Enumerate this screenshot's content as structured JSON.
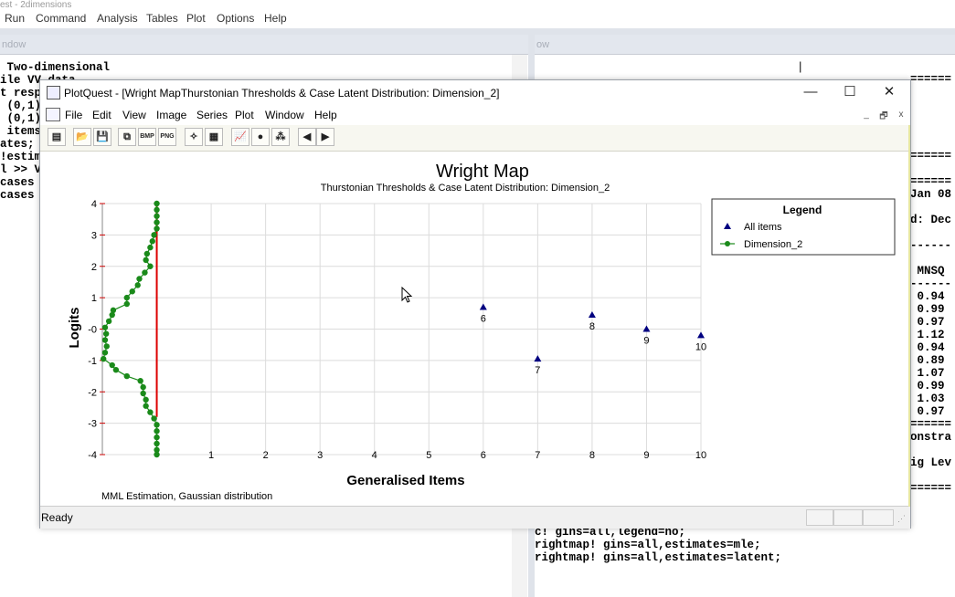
{
  "background_app": {
    "title_fragment": "est - 2dimensions",
    "menu": [
      "Run",
      "Command",
      "Analysis",
      "Tables",
      "Plot",
      "Options",
      "Help"
    ],
    "left_pane_title": "ndow",
    "right_pane_title": "ow",
    "left_text": [
      " Two-dimensional",
      "ile VV data",
      "t resp",
      " (0,1)",
      " (0,1)",
      " items",
      "ates;",
      "!estim",
      "l >> V",
      "cases",
      "cases"
    ],
    "right_top_rule": "======",
    "right_text_1": [
      "======",
      "",
      "",
      "",
      "",
      "",
      "======",
      "",
      "======",
      "Jan 08",
      "",
      "d: Dec",
      "",
      "------",
      "",
      " MNSQ",
      "------",
      " 0.94",
      " 0.99",
      " 0.97",
      " 1.12",
      " 0.94",
      " 0.89",
      " 1.07",
      " 0.99",
      " 1.03",
      " 0.97",
      "======",
      "onstra",
      "",
      "ig Lev",
      "",
      "======"
    ],
    "right_bottom_text": [
      "c! gins=all,legend=no;",
      "rightmap! gins=all,estimates=mle;",
      "rightmap! gins=all,estimates=latent;"
    ]
  },
  "plotquest": {
    "window_title": "PlotQuest - [Wright MapThurstonian Thresholds & Case Latent Distribution: Dimension_2]",
    "window_buttons": [
      "—",
      "☐",
      "✕"
    ],
    "menu": [
      "File",
      "Edit",
      "View",
      "Image",
      "Series",
      "Plot",
      "Window",
      "Help"
    ],
    "mdi_buttons": [
      "_",
      "🗗",
      "x"
    ],
    "toolbar": [
      {
        "name": "new-icon",
        "glyph": "▤"
      },
      {
        "name": "open-icon",
        "glyph": "📂"
      },
      {
        "name": "save-icon",
        "glyph": "💾"
      },
      {
        "name": "copy-icon",
        "glyph": "⧉"
      },
      {
        "name": "bmp-button",
        "glyph": "BMP"
      },
      {
        "name": "png-button",
        "glyph": "PNG"
      },
      {
        "name": "wand-icon",
        "glyph": "✧"
      },
      {
        "name": "properties-icon",
        "glyph": "▦"
      },
      {
        "name": "chart-icon",
        "glyph": "📈"
      },
      {
        "name": "colors-icon",
        "glyph": "●"
      },
      {
        "name": "data-icon",
        "glyph": "⁂"
      },
      {
        "name": "prev-icon",
        "glyph": "◀"
      },
      {
        "name": "next-icon",
        "glyph": "▶"
      }
    ],
    "status_text": "Ready"
  },
  "chart_data": {
    "type": "scatter",
    "title": "Wright Map",
    "subtitle": "Thurstonian Thresholds & Case Latent Distribution: Dimension_2",
    "xlabel": "Generalised Items",
    "ylabel": "Logits",
    "footnote": "MML Estimation, Gaussian distribution",
    "xlim": [
      0,
      10
    ],
    "ylim": [
      -4,
      4
    ],
    "x_ticks": [
      "1",
      "2",
      "3",
      "4",
      "5",
      "6",
      "7",
      "8",
      "9",
      "10"
    ],
    "y_ticks": [
      "4",
      "3",
      "2",
      "1",
      "-0",
      "-1",
      "-2",
      "-3",
      "-4"
    ],
    "grid": true,
    "legend": {
      "title": "Legend",
      "position": "top-right",
      "entries": [
        "All items",
        "Dimension_2"
      ]
    },
    "series": [
      {
        "name": "All items",
        "marker": "triangle",
        "color": "#000080",
        "points": [
          {
            "x": 6,
            "y": 0.7,
            "label": "6"
          },
          {
            "x": 7,
            "y": -0.95,
            "label": "7"
          },
          {
            "x": 8,
            "y": 0.45,
            "label": "8"
          },
          {
            "x": 9,
            "y": 0.0,
            "label": "9"
          },
          {
            "x": 10,
            "y": -0.2,
            "label": "10"
          }
        ]
      },
      {
        "name": "Dimension_2",
        "marker": "circle",
        "color": "#1a8a1a",
        "line_color": "#1a8a1a",
        "points": [
          [
            0.0,
            4.0
          ],
          [
            0.0,
            3.8
          ],
          [
            0.0,
            3.6
          ],
          [
            0.0,
            3.4
          ],
          [
            0.0,
            3.2
          ],
          [
            -0.05,
            3.0
          ],
          [
            -0.08,
            2.8
          ],
          [
            -0.12,
            2.6
          ],
          [
            -0.18,
            2.4
          ],
          [
            -0.2,
            2.2
          ],
          [
            -0.12,
            2.0
          ],
          [
            -0.22,
            1.8
          ],
          [
            -0.32,
            1.6
          ],
          [
            -0.35,
            1.4
          ],
          [
            -0.45,
            1.2
          ],
          [
            -0.55,
            1.0
          ],
          [
            -0.55,
            0.8
          ],
          [
            -0.8,
            0.6
          ],
          [
            -0.82,
            0.45
          ],
          [
            -0.88,
            0.25
          ],
          [
            -0.95,
            0.05
          ],
          [
            -0.93,
            -0.15
          ],
          [
            -0.95,
            -0.35
          ],
          [
            -0.92,
            -0.55
          ],
          [
            -0.95,
            -0.75
          ],
          [
            -0.98,
            -0.95
          ],
          [
            -0.82,
            -1.15
          ],
          [
            -0.75,
            -1.3
          ],
          [
            -0.55,
            -1.5
          ],
          [
            -0.3,
            -1.65
          ],
          [
            -0.25,
            -1.85
          ],
          [
            -0.25,
            -2.05
          ],
          [
            -0.2,
            -2.25
          ],
          [
            -0.2,
            -2.45
          ],
          [
            -0.12,
            -2.65
          ],
          [
            -0.05,
            -2.85
          ],
          [
            0.0,
            -3.05
          ],
          [
            0.0,
            -3.25
          ],
          [
            0.0,
            -3.45
          ],
          [
            0.0,
            -3.65
          ],
          [
            0.0,
            -3.85
          ],
          [
            0.0,
            -4.0
          ]
        ]
      }
    ],
    "zero_line": {
      "x": 0,
      "from": -2.8,
      "to": 4.0,
      "color": "#dd0000"
    }
  }
}
